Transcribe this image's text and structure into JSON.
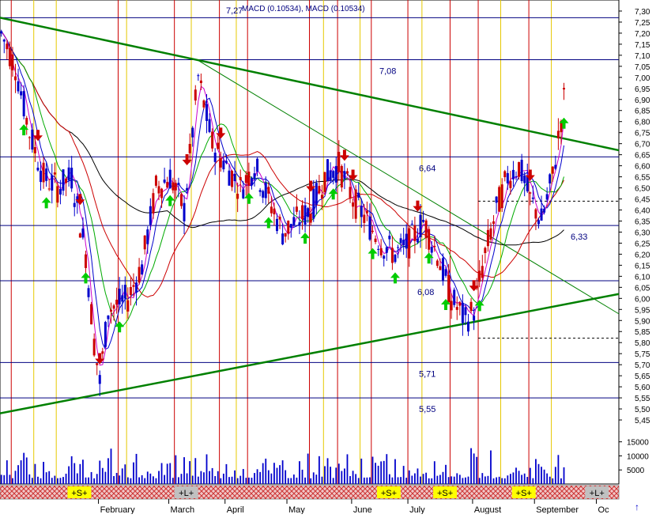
{
  "chart_data": {
    "type": "candlestick",
    "title": "MACD (0.10534), MACD (0.10534)",
    "indicator_value": "7,27",
    "ylim": [
      5.4,
      7.35
    ],
    "y_ticks": [
      "7,30",
      "7,25",
      "7,20",
      "7,15",
      "7,10",
      "7,05",
      "7,00",
      "6,95",
      "6,90",
      "6,85",
      "6,80",
      "6,75",
      "6,70",
      "6,65",
      "6,60",
      "6,55",
      "6,50",
      "6,45",
      "6,40",
      "6,35",
      "6,30",
      "6,25",
      "6,20",
      "6,15",
      "6,10",
      "6,05",
      "6,00",
      "5,95",
      "5,90",
      "5,85",
      "5,80",
      "5,75",
      "5,70",
      "5,65",
      "5,60",
      "5,55",
      "5,50",
      "5,45"
    ],
    "volume_ticks": [
      "15000",
      "10000",
      "5000"
    ],
    "volume_ylim": [
      0,
      18000
    ],
    "x_labels": [
      {
        "label": "February",
        "day": 35
      },
      {
        "label": "March",
        "day": 60
      },
      {
        "label": "April",
        "day": 80
      },
      {
        "label": "May",
        "day": 102
      },
      {
        "label": "June",
        "day": 125
      },
      {
        "label": "July",
        "day": 145
      },
      {
        "label": "August",
        "day": 168
      },
      {
        "label": "September",
        "day": 190
      },
      {
        "label": "Oc",
        "day": 212
      }
    ],
    "days": 220,
    "support_resistance_levels": [
      {
        "value": 7.27,
        "label": ""
      },
      {
        "value": 7.08,
        "label": "7,08"
      },
      {
        "value": 6.64,
        "label": "6,64"
      },
      {
        "value": 6.33,
        "label": "6,33"
      },
      {
        "value": 6.08,
        "label": "6,08"
      },
      {
        "value": 5.71,
        "label": "5,71"
      },
      {
        "value": 5.55,
        "label": "5,55"
      }
    ],
    "dashed_levels": [
      6.44,
      5.82
    ],
    "trend_lines": [
      {
        "name": "resistance",
        "from": [
          0,
          7.27
        ],
        "to": [
          220,
          6.67
        ]
      },
      {
        "name": "support",
        "from": [
          0,
          5.48
        ],
        "to": [
          220,
          6.02
        ]
      },
      {
        "name": "thin-trend",
        "from": [
          70,
          7.08
        ],
        "to": [
          220,
          5.93
        ]
      }
    ],
    "price_series": [
      {
        "day": 0,
        "value": 7.2
      },
      {
        "day": 5,
        "value": 7.05
      },
      {
        "day": 10,
        "value": 6.75
      },
      {
        "day": 15,
        "value": 6.55
      },
      {
        "day": 20,
        "value": 6.5
      },
      {
        "day": 25,
        "value": 6.55
      },
      {
        "day": 30,
        "value": 6.2
      },
      {
        "day": 33,
        "value": 5.8
      },
      {
        "day": 35,
        "value": 5.62
      },
      {
        "day": 38,
        "value": 5.95
      },
      {
        "day": 45,
        "value": 6.0
      },
      {
        "day": 50,
        "value": 6.15
      },
      {
        "day": 55,
        "value": 6.5
      },
      {
        "day": 60,
        "value": 6.55
      },
      {
        "day": 65,
        "value": 6.4
      },
      {
        "day": 70,
        "value": 7.0
      },
      {
        "day": 75,
        "value": 6.7
      },
      {
        "day": 80,
        "value": 6.6
      },
      {
        "day": 85,
        "value": 6.5
      },
      {
        "day": 90,
        "value": 6.6
      },
      {
        "day": 95,
        "value": 6.45
      },
      {
        "day": 100,
        "value": 6.3
      },
      {
        "day": 105,
        "value": 6.35
      },
      {
        "day": 110,
        "value": 6.4
      },
      {
        "day": 115,
        "value": 6.55
      },
      {
        "day": 120,
        "value": 6.6
      },
      {
        "day": 125,
        "value": 6.45
      },
      {
        "day": 130,
        "value": 6.35
      },
      {
        "day": 135,
        "value": 6.25
      },
      {
        "day": 140,
        "value": 6.2
      },
      {
        "day": 145,
        "value": 6.25
      },
      {
        "day": 150,
        "value": 6.35
      },
      {
        "day": 155,
        "value": 6.2
      },
      {
        "day": 160,
        "value": 6.0
      },
      {
        "day": 165,
        "value": 5.9
      },
      {
        "day": 168,
        "value": 5.95
      },
      {
        "day": 172,
        "value": 6.2
      },
      {
        "day": 176,
        "value": 6.4
      },
      {
        "day": 180,
        "value": 6.55
      },
      {
        "day": 184,
        "value": 6.6
      },
      {
        "day": 188,
        "value": 6.45
      },
      {
        "day": 192,
        "value": 6.35
      },
      {
        "day": 196,
        "value": 6.55
      },
      {
        "day": 200,
        "value": 6.9
      }
    ],
    "buy_arrows": [
      8,
      16,
      30,
      42,
      60,
      88,
      95,
      108,
      118,
      132,
      140,
      152,
      158,
      170,
      200
    ],
    "sell_arrows": [
      13,
      28,
      35,
      66,
      78,
      110,
      122,
      125,
      148,
      168,
      188
    ],
    "bottom_band": [
      {
        "label": "+S+",
        "day": 40
      },
      {
        "label": "+L+",
        "day": 72
      },
      {
        "label": "+S+",
        "day": 128
      },
      {
        "label": "+S+",
        "day": 155
      },
      {
        "label": "+S+",
        "day": 195
      },
      {
        "label": "+L+",
        "day": 220
      }
    ],
    "colors": {
      "up_candle": "#0000cc",
      "down_candle": "#cc0000",
      "trend": "#008000",
      "level": "#000080",
      "buy_arrow": "#00cc00",
      "sell_arrow": "#cc0000",
      "vline_red": "#cc0000",
      "vline_yellow": "#e6c800",
      "ma_long": "#000000",
      "ma_red": "#cc0000",
      "ma_green": "#00aa00",
      "ma_blue": "#0000cc",
      "ma_magenta": "#cc00cc"
    }
  },
  "ui": {
    "up_arrow": "↑"
  }
}
